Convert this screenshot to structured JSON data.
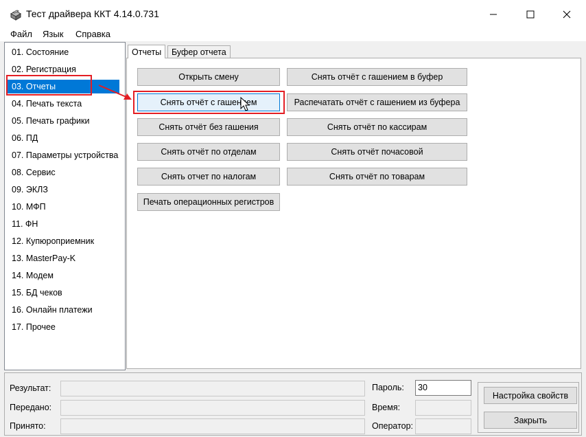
{
  "window": {
    "title": "Тест драйвера ККТ 4.14.0.731"
  },
  "menu": [
    "Файл",
    "Язык",
    "Справка"
  ],
  "nav": [
    "01. Состояние",
    "02. Регистрация",
    "03. Отчеты",
    "04. Печать текста",
    "05. Печать графики",
    "06. ПД",
    "07. Параметры устройства",
    "08. Сервис",
    "09. ЭКЛЗ",
    "10. МФП",
    "11. ФН",
    "12. Купюроприемник",
    "13. MasterPay-K",
    "14. Модем",
    "15. БД чеков",
    "16. Онлайн платежи",
    "17. Прочее"
  ],
  "tabs": [
    "Отчеты",
    "Буфер отчета"
  ],
  "buttons": {
    "open_shift": "Открыть смену",
    "z_report_to_buffer": "Снять отчёт с гашением в буфер",
    "z_report": "Снять отчёт с гашением",
    "print_z_report_from_buffer": "Распечатать отчёт с гашением из буфера",
    "x_report": "Снять отчёт без гашения",
    "cashiers_report": "Снять отчёт по кассирам",
    "departments_report": "Снять отчёт по отделам",
    "hourly_report": "Снять отчёт почасовой",
    "taxes_report": "Снять отчет по налогам",
    "goods_report": "Снять отчёт по товарам",
    "print_op_registers": "Печать операционных регистров"
  },
  "status": {
    "result_label": "Результат:",
    "sent_label": "Передано:",
    "received_label": "Принято:",
    "password_label": "Пароль:",
    "password_value": "30",
    "time_label": "Время:",
    "operator_label": "Оператор:"
  },
  "actions": {
    "settings": "Настройка свойств",
    "close": "Закрыть"
  },
  "colors": {
    "selection": "#0078d7",
    "annotation": "#e31e24",
    "hover_fill": "#e5f1fb"
  }
}
